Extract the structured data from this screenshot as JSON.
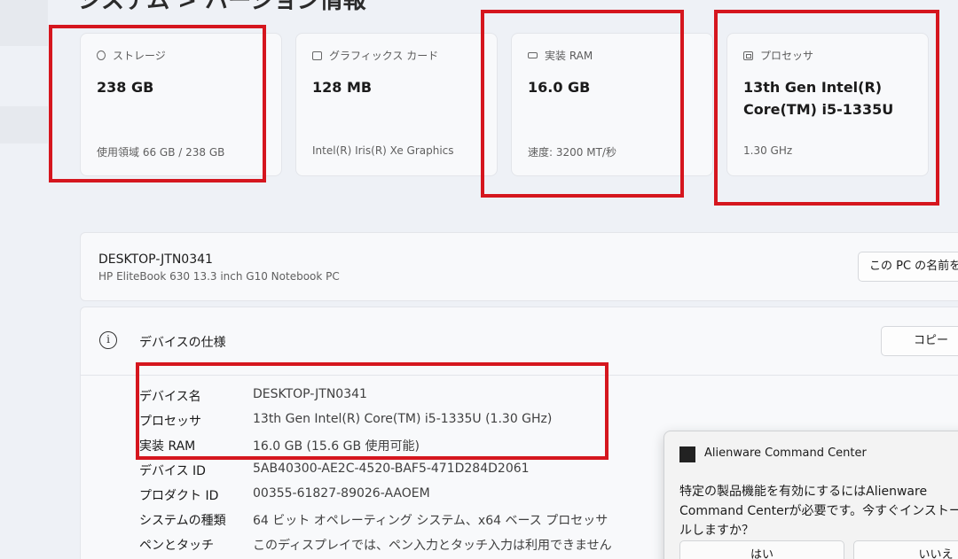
{
  "page": {
    "title": "システム > バージョン情報"
  },
  "cards": [
    {
      "icon": "storage-icon",
      "label": "ストレージ",
      "value": "238 GB",
      "sub": "使用領域 66 GB / 238 GB"
    },
    {
      "icon": "graphics-card-icon",
      "label": "グラフィックス カード",
      "value": "128 MB",
      "sub": "Intel(R) Iris(R) Xe Graphics"
    },
    {
      "icon": "ram-icon",
      "label": "実装 RAM",
      "value": "16.0 GB",
      "sub": "速度: 3200 MT/秒"
    },
    {
      "icon": "processor-icon",
      "label": "プロセッサ",
      "value_line1": "13th Gen Intel(R)",
      "value_line2": "Core(TM) i5-1335U",
      "sub": "1.30 GHz"
    }
  ],
  "device": {
    "name": "DESKTOP-JTN0341",
    "model": "HP EliteBook 630 13.3 inch G10 Notebook PC",
    "rename_button": "この PC の名前を変更"
  },
  "specs": {
    "title": "デバイスの仕様",
    "copy_button": "コピー",
    "rows": [
      {
        "key": "デバイス名",
        "value": "DESKTOP-JTN0341"
      },
      {
        "key": "プロセッサ",
        "value": "13th Gen Intel(R) Core(TM) i5-1335U (1.30 GHz)"
      },
      {
        "key": "実装 RAM",
        "value": "16.0 GB (15.6 GB 使用可能)"
      },
      {
        "key": "デバイス ID",
        "value": "5AB40300-AE2C-4520-BAF5-471D284D2061"
      },
      {
        "key": "プロダクト ID",
        "value": "00355-61827-89026-AAOEM"
      },
      {
        "key": "システムの種類",
        "value": "64 ビット オペレーティング システム、x64 ベース プロセッサ"
      },
      {
        "key": "ペンとタッチ",
        "value": "このディスプレイでは、ペン入力とタッチ入力は利用できません"
      }
    ]
  },
  "notification": {
    "app": "Alienware Command Center",
    "message": "特定の製品機能を有効にするにはAlienware Command Centerが必要です。今すぐインストールしますか？",
    "yes_button": "はい",
    "no_button": "いいえ"
  },
  "colors": {
    "highlight": "#d5161e",
    "background": "#eef1f6",
    "card": "#f8f9fb"
  }
}
